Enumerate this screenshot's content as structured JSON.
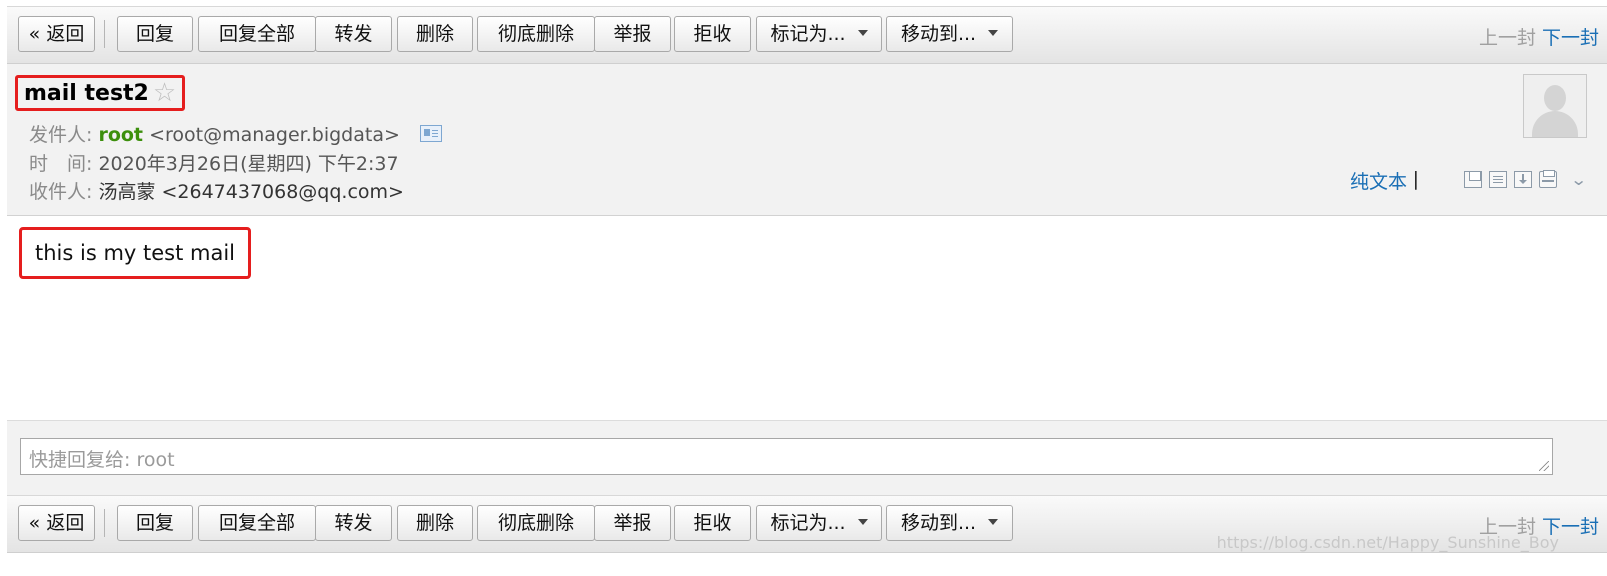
{
  "toolbar": {
    "back": "« 返回",
    "reply": "回复",
    "reply_all": "回复全部",
    "forward": "转发",
    "delete": "删除",
    "delete_permanently": "彻底删除",
    "report": "举报",
    "reject": "拒收",
    "mark_as": "标记为...",
    "move_to": "移动到...",
    "prev": "上一封",
    "next": "下一封"
  },
  "mail": {
    "subject": "mail test2",
    "star": "☆",
    "sender_label": "发件人:",
    "sender_name": "root",
    "sender_address": "<root@manager.bigdata>",
    "time_label": "时　间:",
    "time_value": "2020年3月26日(星期四) 下午2:37",
    "recipient_label": "收件人:",
    "recipient_value": "汤高蒙 <2647437068@qq.com>",
    "plain_text": "纯文本",
    "separator": "|",
    "body": "this is my test mail"
  },
  "quick_reply": {
    "placeholder": "快捷回复给: root"
  },
  "watermark": "https://blog.csdn.net/Happy_Sunshine_Boy",
  "colors": {
    "accent_link": "#1a6fb5",
    "sender_green": "#3c8f0c",
    "highlight_red": "#e51e1e"
  }
}
